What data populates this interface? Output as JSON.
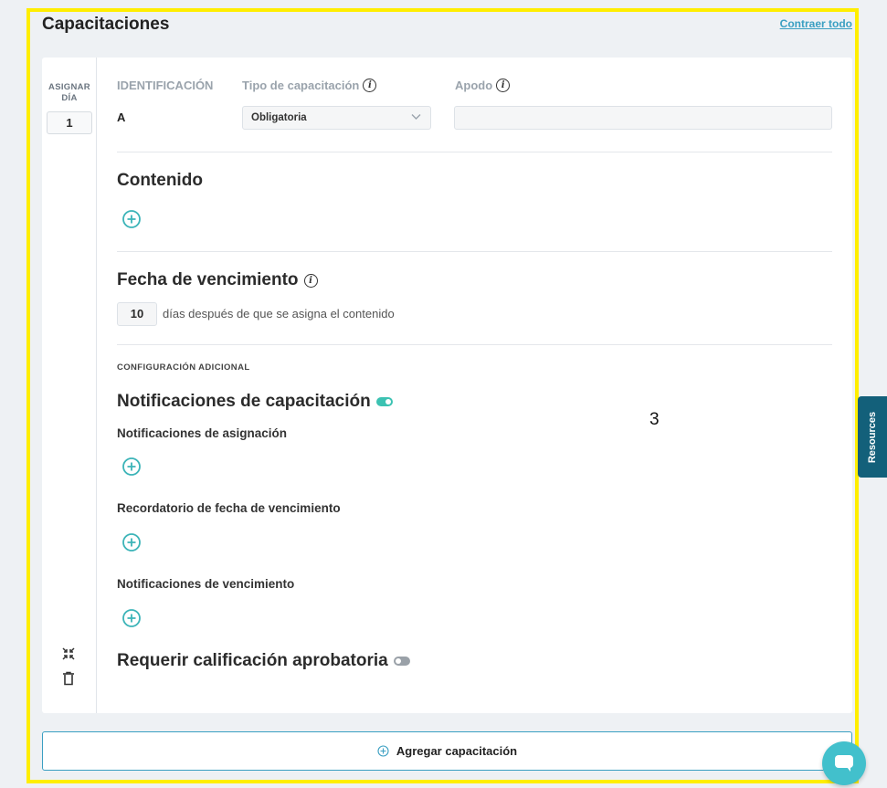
{
  "section": {
    "title": "Capacitaciones",
    "collapse_all": "Contraer todo"
  },
  "rail": {
    "assign_day_label": "ASIGNAR DÍA",
    "day_value": "1"
  },
  "identification": {
    "label": "IDENTIFICACIÓN",
    "value": "A"
  },
  "training_type": {
    "label": "Tipo de capacitación",
    "selected": "Obligatoria"
  },
  "nickname": {
    "label": "Apodo",
    "value": ""
  },
  "content_section": {
    "title": "Contenido"
  },
  "due_date": {
    "title": "Fecha de vencimiento",
    "days_value": "10",
    "days_text": "días después de que se asigna el contenido"
  },
  "additional_config": {
    "label": "CONFIGURACIÓN ADICIONAL"
  },
  "notifications": {
    "title": "Notificaciones de capacitación",
    "enabled": true,
    "assignment": "Notificaciones de asignación",
    "due_reminder": "Recordatorio de fecha de vencimiento",
    "expiration": "Notificaciones de vencimiento"
  },
  "passing_grade": {
    "title": "Requerir calificación aprobatoria",
    "enabled": false
  },
  "add_training": {
    "label": "Agregar capacitación"
  },
  "overlay": {
    "number": "3"
  },
  "resources_tab": {
    "label": "Resources"
  },
  "colors": {
    "accent": "#3a9fc2",
    "teal": "#3cc2b2",
    "highlight": "#ffee00",
    "resources": "#13607a"
  }
}
